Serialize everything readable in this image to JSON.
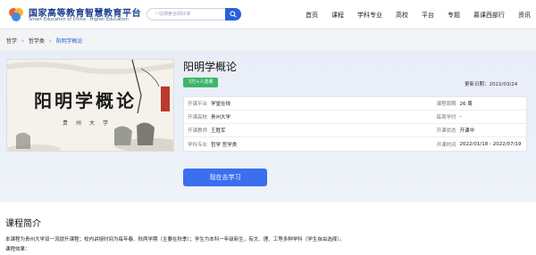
{
  "header": {
    "logo_cn": "国家高等教育智慧教育平台",
    "logo_en": "Smart Education of China · Higher Education",
    "search_placeholder": "一站搜索全网好课",
    "nav": [
      "首页",
      "课程",
      "学科专业",
      "高校",
      "平台",
      "专题",
      "慕课西部行",
      "资讯"
    ]
  },
  "breadcrumb": {
    "items": [
      "哲学",
      "哲学类",
      "阳明学概论"
    ]
  },
  "cover": {
    "title": "阳明学概论",
    "subtitle": "贵州大学"
  },
  "course": {
    "title": "阳明学概论",
    "enroll_badge": "3万+人选课",
    "update_label": "更新日期：",
    "update_date": "2022/03/24",
    "rows": [
      {
        "l_label": "开课平台",
        "l_val": "学堂在线",
        "r_label": "课程周期",
        "r_val": "26 周"
      },
      {
        "l_label": "开课高校",
        "l_val": "贵州大学",
        "r_label": "每周学时",
        "r_val": "-"
      },
      {
        "l_label": "开课教师",
        "l_val": "王胜军",
        "r_label": "开课状态",
        "r_val": "开课中"
      },
      {
        "l_label": "学科专业",
        "l_val": "哲学 哲学类",
        "r_label": "开课时间",
        "r_val": "2022/01/18 - 2022/07/19"
      }
    ],
    "study_button": "现在去学习"
  },
  "intro": {
    "title": "课程简介",
    "text": "本课程为贵州大学双一流提升课程；校内讲授时间为每年春、秋两学期（主要在秋季）；学生为本科一年级新生，有文、理、工等多种学科（学生自由选择）。",
    "effect": "课程效果："
  },
  "colors": {
    "brand_blue": "#2962d8",
    "button_blue": "#3a6ff0",
    "badge_green": "#3fb56b"
  }
}
